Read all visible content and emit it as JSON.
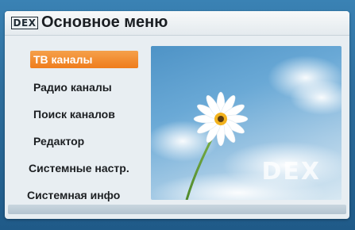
{
  "header": {
    "logo_text": "DEX",
    "title": "Основное меню"
  },
  "menu": {
    "items": [
      {
        "label": "ТВ каналы",
        "selected": true
      },
      {
        "label": "Радио каналы",
        "selected": false
      },
      {
        "label": "Поиск каналов",
        "selected": false
      },
      {
        "label": "Редактор",
        "selected": false
      },
      {
        "label": "Системные настр.",
        "selected": false
      },
      {
        "label": "Системная инфо",
        "selected": false
      }
    ]
  },
  "preview": {
    "watermark": "DEX"
  },
  "colors": {
    "selection": "#ef7d1d",
    "background": "#2f6f9c",
    "panel": "#e8eef2"
  }
}
